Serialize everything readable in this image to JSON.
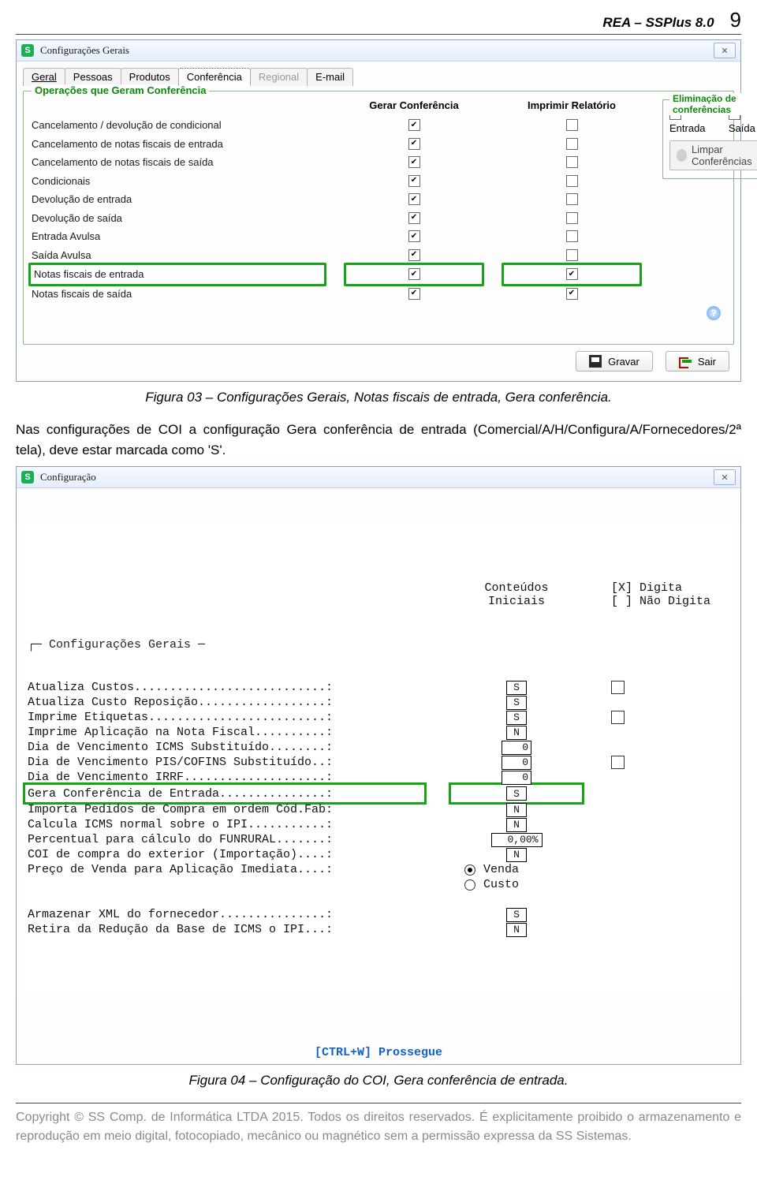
{
  "header": {
    "title": "REA – SSPlus 8.0",
    "page": "9"
  },
  "win1": {
    "title": "Configurações Gerais",
    "tabs": [
      "Geral",
      "Pessoas",
      "Produtos",
      "Conferência",
      "Regional",
      "E-mail"
    ],
    "group_legend": "Operações que Geram Conferência",
    "col_gerar": "Gerar Conferência",
    "col_imp": "Imprimir Relatório",
    "rows": [
      {
        "label": "Cancelamento / devolução de condicional",
        "gerar": true,
        "imp": false
      },
      {
        "label": "Cancelamento de notas fiscais de entrada",
        "gerar": true,
        "imp": false
      },
      {
        "label": "Cancelamento de notas fiscais de saída",
        "gerar": true,
        "imp": false
      },
      {
        "label": "Condicionais",
        "gerar": true,
        "imp": false
      },
      {
        "label": "Devolução de entrada",
        "gerar": true,
        "imp": false
      },
      {
        "label": "Devolução de saída",
        "gerar": true,
        "imp": false
      },
      {
        "label": "Entrada Avulsa",
        "gerar": true,
        "imp": false
      },
      {
        "label": "Saída Avulsa",
        "gerar": true,
        "imp": false
      },
      {
        "label": "Notas fiscais de entrada",
        "gerar": true,
        "imp": true,
        "hl": true
      },
      {
        "label": "Notas fiscais de saída",
        "gerar": true,
        "imp": true
      }
    ],
    "elim": {
      "legend": "Eliminação de conferências",
      "entrada": "Entrada",
      "saida": "Saída",
      "limpar": "Limpar Conferências"
    },
    "gravar": "Gravar",
    "sair": "Sair"
  },
  "caption1": "Figura 03 – Configurações Gerais, Notas fiscais de entrada, Gera conferência.",
  "para1": "Nas configurações de COI a configuração Gera conferência de entrada (Comercial/A/H/Configura/A/Fornecedores/2ª tela), deve estar marcada como 'S'.",
  "win2": {
    "title": "Configuração",
    "mid_head": "Conteúdos\nIniciais",
    "right_head": "[X] Digita\n[ ] Não Digita",
    "group_label": "Configurações Gerais",
    "rows": [
      {
        "label": "Atualiza Custos...........................:",
        "val": "S",
        "chk": true
      },
      {
        "label": "Atualiza Custo Reposição..................:",
        "val": "S"
      },
      {
        "label": "Imprime Etiquetas.........................:",
        "val": "S",
        "chk": true
      },
      {
        "label": "Imprime Aplicação na Nota Fiscal..........:",
        "val": "N"
      },
      {
        "label": "Dia de Vencimento ICMS Substituído........:",
        "val": "0",
        "num": true
      },
      {
        "label": "Dia de Vencimento PIS/COFINS Substituído..:",
        "val": "0",
        "num": true,
        "chk": true
      },
      {
        "label": "Dia de Vencimento IRRF....................:",
        "val": "0",
        "num": true
      },
      {
        "label": "Gera Conferência de Entrada...............:",
        "val": "S",
        "hl": true
      },
      {
        "label": "Importa Pedidos de Compra em ordem Cód.Fab:",
        "val": "N"
      },
      {
        "label": "Calcula ICMS normal sobre o IPI...........:",
        "val": "N"
      },
      {
        "label": "Percentual para cálculo do FUNRURAL.......:",
        "val": "0,00%",
        "wide": true
      },
      {
        "label": "COI de compra do exterior (Importação)....:",
        "val": "N"
      },
      {
        "label": "Preço de Venda para Aplicação Imediata....:",
        "radio": true,
        "venda": "Venda",
        "custo": "Custo"
      },
      {
        "label": "",
        "empty": true
      },
      {
        "label": "Armazenar XML do fornecedor...............:",
        "val": "S"
      },
      {
        "label": "Retira da Redução da Base de ICMS o IPI...:",
        "val": "N"
      }
    ],
    "prossegue": "[CTRL+W]  Prossegue"
  },
  "caption2": "Figura 04 – Configuração do COI, Gera conferência de entrada.",
  "footer": "Copyright © SS Comp. de Informática LTDA 2015. Todos os direitos reservados. É explicitamente proibido o armazenamento e reprodução em meio digital, fotocopiado, mecânico ou magnético sem a permissão expressa da SS Sistemas."
}
